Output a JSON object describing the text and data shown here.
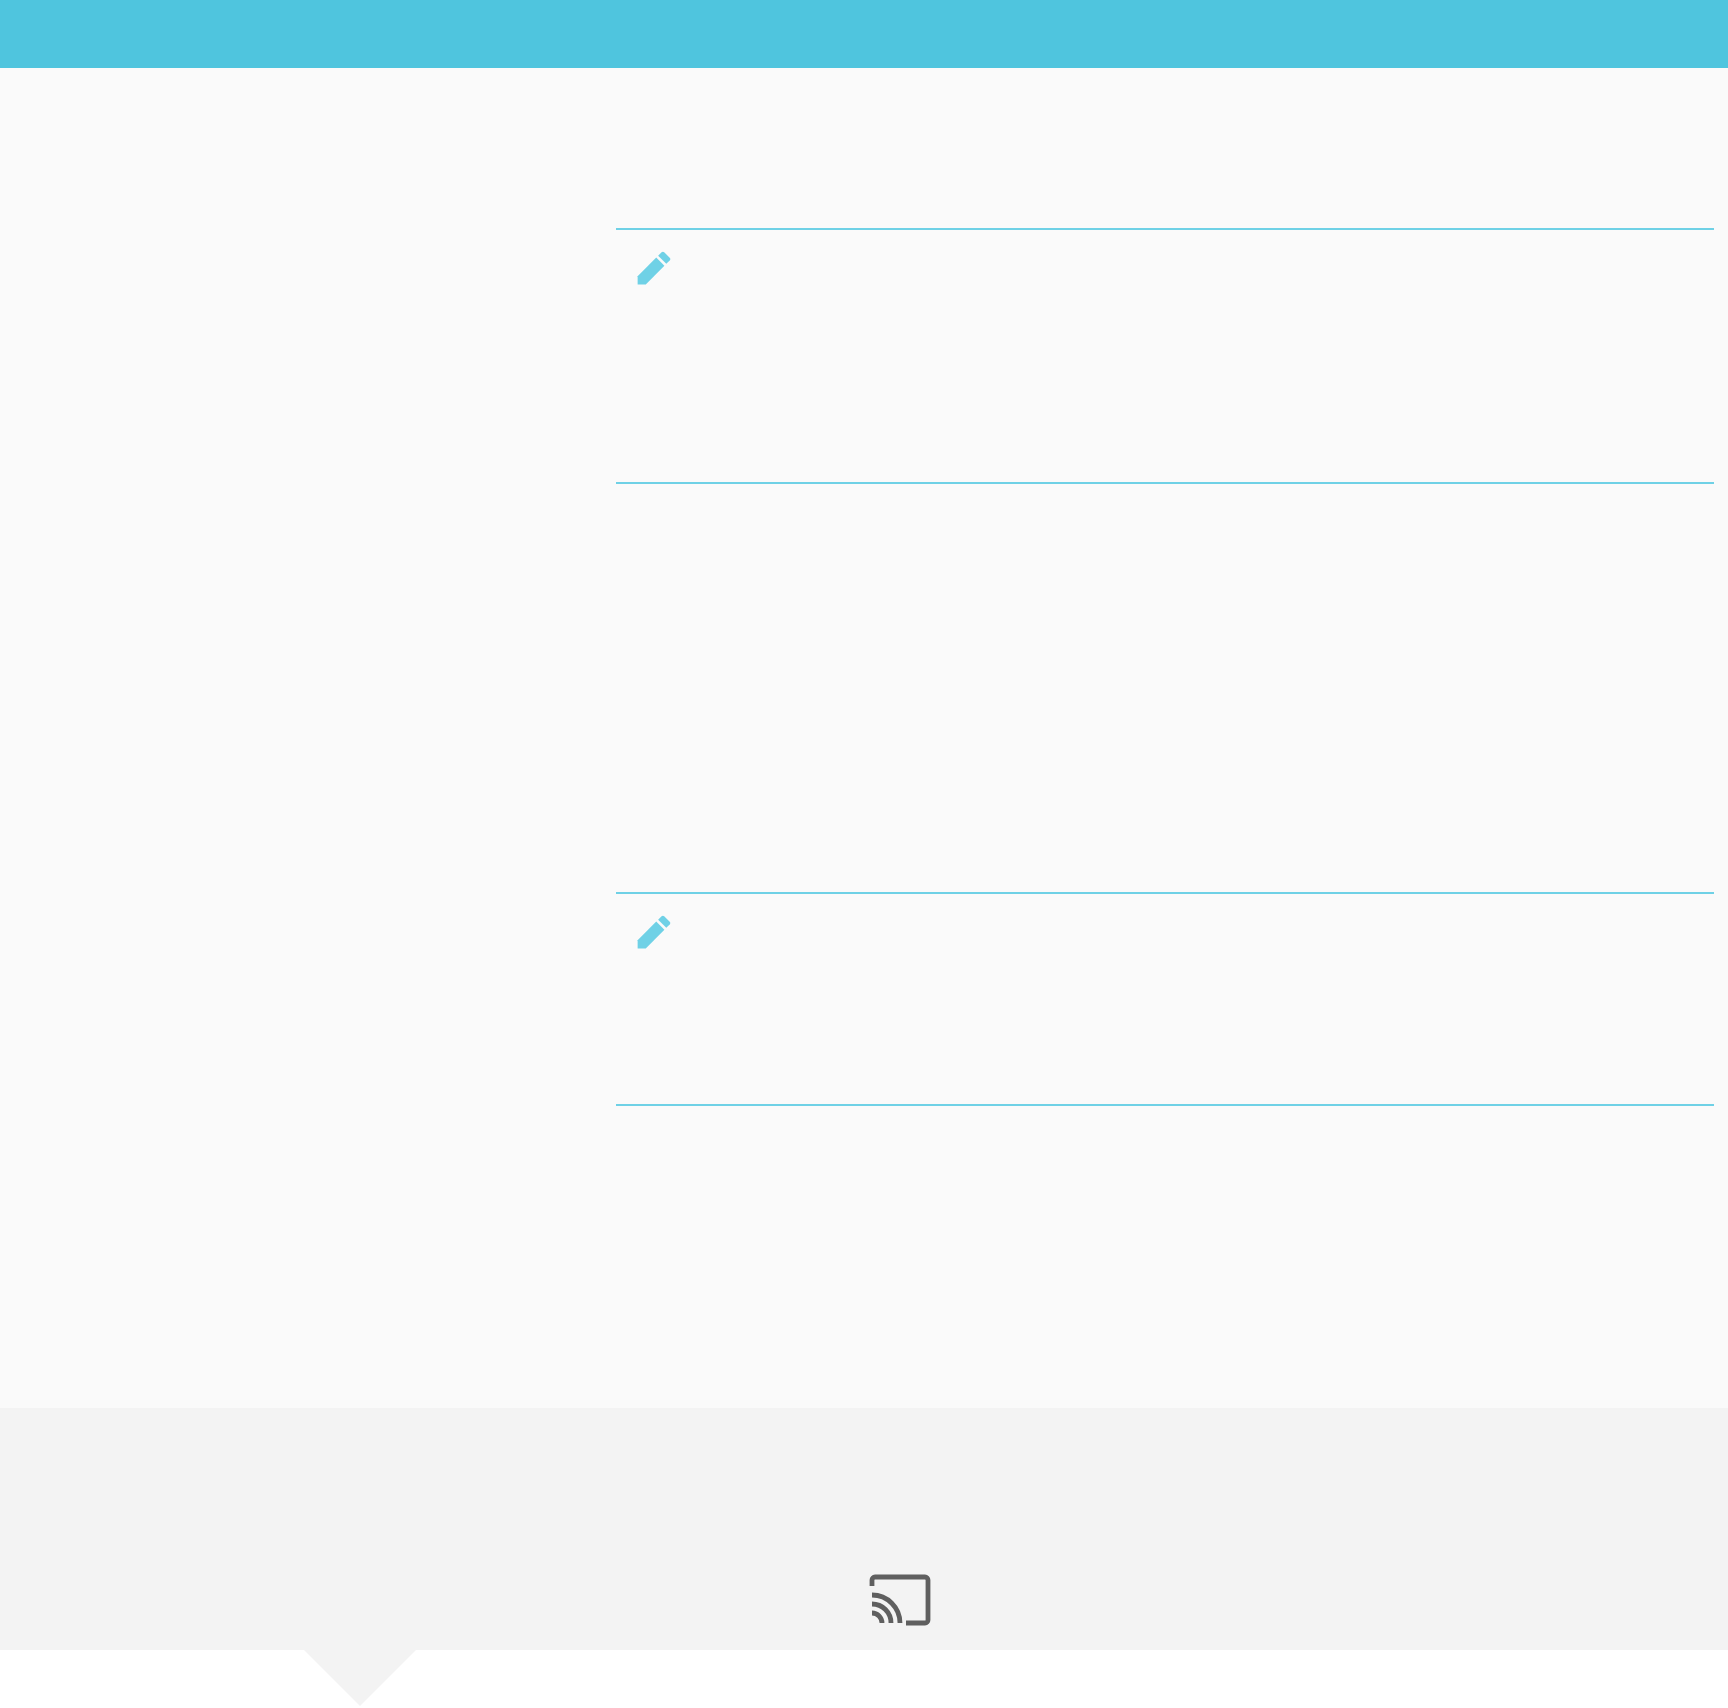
{
  "notes": [
    {
      "kind": "editable"
    },
    {
      "kind": "editable"
    }
  ],
  "footer": {
    "cast_button": true,
    "pointer": true
  }
}
